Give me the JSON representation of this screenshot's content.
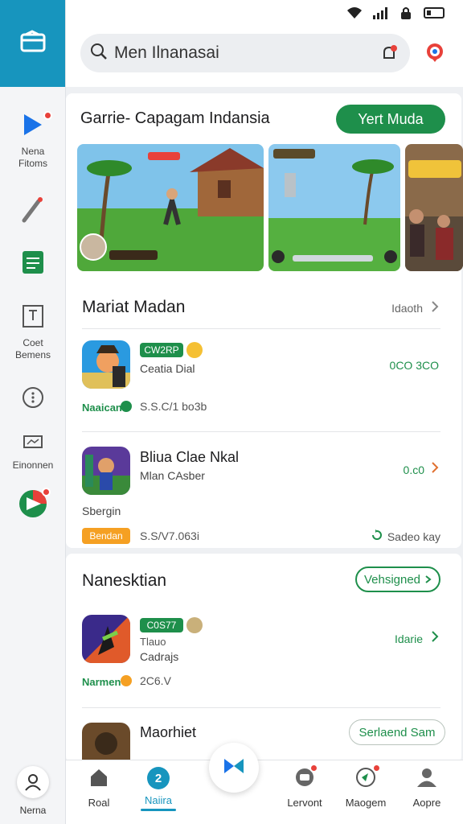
{
  "rail": {
    "items": [
      {
        "label": "Nena\nFitoms"
      },
      {
        "label": ""
      },
      {
        "label": ""
      },
      {
        "label": "Coet\nBemens"
      },
      {
        "label": ""
      },
      {
        "label": "Einonnen"
      },
      {
        "label": ""
      }
    ],
    "profile_label": "Nerna"
  },
  "search": {
    "text": "Men Ilnanasai"
  },
  "featured": {
    "title": "Garrie- Capagam Indansia",
    "button": "Yert Muda",
    "banner_badges": [
      "",
      "",
      ""
    ]
  },
  "section1": {
    "title": "Mariat Madan",
    "more": "Idaoth",
    "apps": [
      {
        "pill": "CW2RP",
        "name": "Ceatia Dial",
        "sub": "",
        "tag": "Naaican",
        "size": "S.S.C/1 bo3b",
        "price": "0CO 3CO"
      },
      {
        "pill": "",
        "name": "Bliua Clae Nkal",
        "sub": "Mlan CAsber",
        "tag": "Sbergin",
        "orange_pill": "Bendan",
        "size": "S.S/V7.063i",
        "price": "0.c0",
        "extra": "Sadeo kay"
      }
    ]
  },
  "section2": {
    "title": "Nanesktian",
    "button": "Vehsigned",
    "apps": [
      {
        "pill": "C0S77",
        "name": "Tlauo",
        "sub": "Cadrajs",
        "tag": "Narmen",
        "size": "2C6.V",
        "price": "Idarie"
      },
      {
        "pill": "",
        "name": "Maorhiet",
        "sub": "",
        "button": "Serlaend Sam"
      }
    ]
  },
  "bottomnav": {
    "items": [
      {
        "label": "Roal"
      },
      {
        "label": "Naiira"
      },
      {
        "label": "Lervont"
      },
      {
        "label": "Maogem"
      },
      {
        "label": "Aopre"
      }
    ]
  },
  "colors": {
    "accent": "#1e8f4b",
    "rail_top": "#1795be",
    "badge": "#e8413a",
    "orange": "#f5a023"
  }
}
